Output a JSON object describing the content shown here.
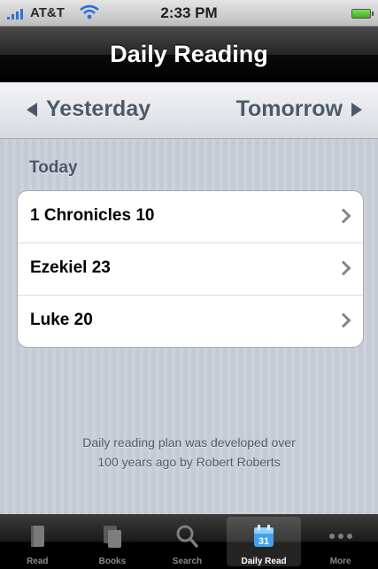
{
  "status_bar": {
    "carrier": "AT&T",
    "time": "2:33 PM"
  },
  "nav_bar": {
    "title": "Daily Reading"
  },
  "day_nav": {
    "prev_label": "Yesterday",
    "next_label": "Tomorrow"
  },
  "reading_list": {
    "section_title": "Today",
    "items": [
      {
        "label": "1 Chronicles 10"
      },
      {
        "label": "Ezekiel 23"
      },
      {
        "label": "Luke 20"
      }
    ]
  },
  "footer_note": {
    "line1": "Daily reading plan was developed over",
    "line2": "100 years ago by Robert Roberts"
  },
  "tab_bar": {
    "tabs": [
      {
        "label": "Read",
        "icon": "book-icon",
        "active": false
      },
      {
        "label": "Books",
        "icon": "books-icon",
        "active": false
      },
      {
        "label": "Search",
        "icon": "magnifier-icon",
        "active": false
      },
      {
        "label": "Daily Read",
        "icon": "calendar-icon",
        "active": true
      },
      {
        "label": "More",
        "icon": "more-dots-icon",
        "active": false
      }
    ],
    "calendar_day": "31"
  },
  "colors": {
    "accent": "#2f6fd6",
    "nav_text": "#4d5968",
    "title_bar": "#000000"
  }
}
